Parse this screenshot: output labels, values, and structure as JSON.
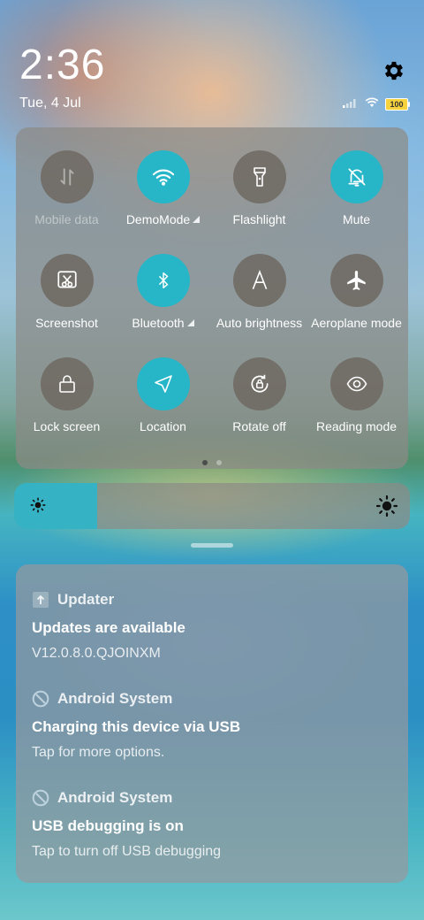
{
  "status": {
    "time": "2:36",
    "date": "Tue, 4 Jul",
    "battery": "100"
  },
  "quick_settings": {
    "tiles": [
      {
        "label": "Mobile data",
        "icon": "mobile-data-icon",
        "active": false,
        "disabled": true
      },
      {
        "label": "DemoMode",
        "icon": "wifi-icon",
        "active": true,
        "expandable": true
      },
      {
        "label": "Flashlight",
        "icon": "flashlight-icon",
        "active": false
      },
      {
        "label": "Mute",
        "icon": "bell-off-icon",
        "active": true
      },
      {
        "label": "Screenshot",
        "icon": "screenshot-icon",
        "active": false
      },
      {
        "label": "Bluetooth",
        "icon": "bluetooth-icon",
        "active": true,
        "expandable": true
      },
      {
        "label": "Auto brightness",
        "icon": "auto-brightness-icon",
        "active": false
      },
      {
        "label": "Aeroplane mode",
        "icon": "airplane-icon",
        "active": false
      },
      {
        "label": "Lock screen",
        "icon": "lock-icon",
        "active": false
      },
      {
        "label": "Location",
        "icon": "location-icon",
        "active": true
      },
      {
        "label": "Rotate off",
        "icon": "rotate-lock-icon",
        "active": false
      },
      {
        "label": "Reading mode",
        "icon": "eye-icon",
        "active": false
      }
    ],
    "page_count": 2,
    "current_page": 1
  },
  "brightness": {
    "level": 0.21
  },
  "notifications": [
    {
      "app": "Updater",
      "icon": "updater-icon",
      "title": "Updates are available",
      "body": "V12.0.8.0.QJOINXM"
    },
    {
      "app": "Android System",
      "icon": "android-system-icon",
      "title": "Charging this device via USB",
      "body": "Tap for more options."
    },
    {
      "app": "Android System",
      "icon": "android-system-icon",
      "title": "USB debugging is on",
      "body": "Tap to turn off USB debugging"
    }
  ],
  "colors": {
    "accent": "#26b6c7",
    "tile_off": "#6e6862"
  }
}
